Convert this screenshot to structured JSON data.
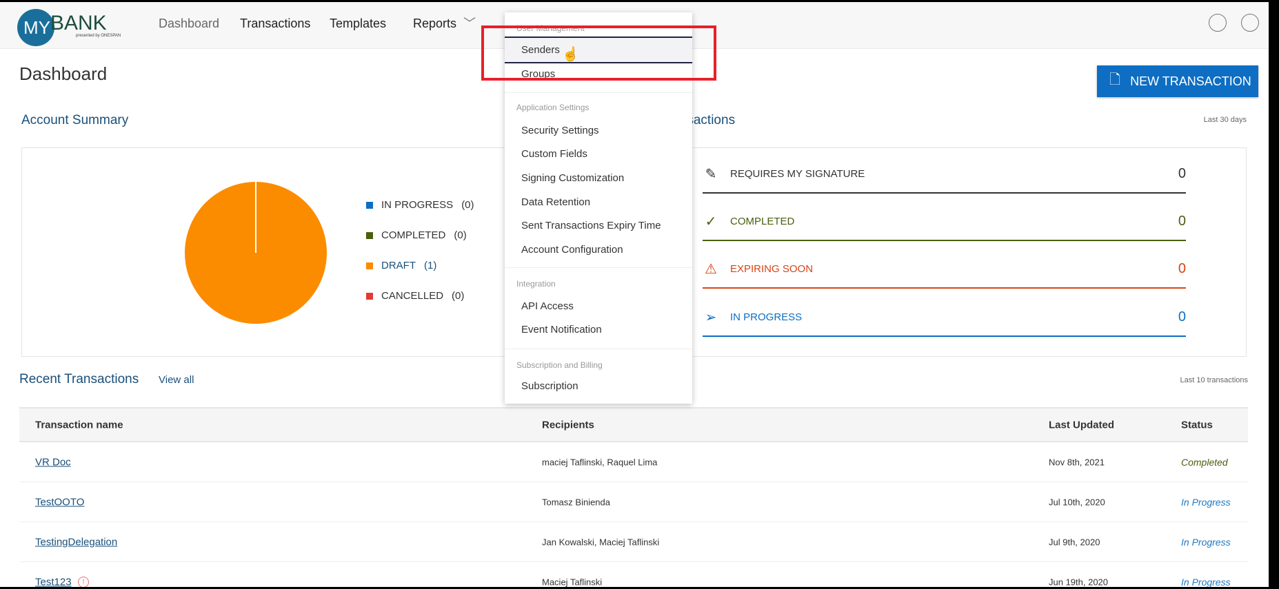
{
  "header": {
    "logo_my": "MY",
    "logo_bank": "BANK",
    "logo_sub": "presented by ONESPAN",
    "nav": [
      "Dashboard",
      "Transactions",
      "Templates",
      "Reports"
    ],
    "icons": [
      "globe-icon",
      "user-icon"
    ]
  },
  "page": {
    "title": "Dashboard",
    "new_transaction": "NEW TRANSACTION"
  },
  "summary": {
    "title": "Account Summary",
    "legend": [
      {
        "label": "IN PROGRESS",
        "count": "(0)",
        "color": "#0d6ec3"
      },
      {
        "label": "COMPLETED",
        "count": "(0)",
        "color": "#4a5e0e"
      },
      {
        "label": "DRAFT",
        "count": "(1)",
        "color": "#fb8c00"
      },
      {
        "label": "CANCELLED",
        "count": "(0)",
        "color": "#e53935"
      }
    ]
  },
  "chart_data": {
    "type": "pie",
    "categories": [
      "IN PROGRESS",
      "COMPLETED",
      "DRAFT",
      "CANCELLED"
    ],
    "values": [
      0,
      0,
      1,
      0
    ]
  },
  "transactions": {
    "title": "Transactions",
    "range": "Last 30 days",
    "stats": [
      {
        "label": "REQUIRES MY SIGNATURE",
        "value": "0",
        "icon": "pencil-icon",
        "color": "#333333"
      },
      {
        "label": "COMPLETED",
        "value": "0",
        "icon": "check-icon",
        "color": "#4a5e0e"
      },
      {
        "label": "EXPIRING SOON",
        "value": "0",
        "icon": "warning-icon",
        "color": "#d84315"
      },
      {
        "label": "IN PROGRESS",
        "value": "0",
        "icon": "send-icon",
        "color": "#0d6ec3"
      }
    ]
  },
  "recent": {
    "title": "Recent Transactions",
    "view_all": "View all",
    "range": "Last 10 transactions",
    "columns": [
      "Transaction name",
      "Recipients",
      "Last Updated",
      "Status"
    ],
    "rows": [
      {
        "name": "VR Doc",
        "recipients": "maciej Taflinski, Raquel Lima",
        "updated": "Nov 8th, 2021",
        "status": "Completed"
      },
      {
        "name": "TestOOTO",
        "recipients": "Tomasz Binienda",
        "updated": "Jul 10th, 2020",
        "status": "In Progress"
      },
      {
        "name": "TestingDelegation",
        "recipients": "Jan Kowalski, Maciej Taflinski",
        "updated": "Jul 9th, 2020",
        "status": "In Progress"
      },
      {
        "name": "Test123",
        "recipients": "Maciej Taflinski",
        "updated": "Jun 19th, 2020",
        "status": "In Progress"
      }
    ]
  },
  "menu": {
    "sections": [
      {
        "header": "User Management",
        "items": [
          "Senders",
          "Groups"
        ]
      },
      {
        "header": "Application Settings",
        "items": [
          "Security Settings",
          "Custom Fields",
          "Signing Customization",
          "Data Retention",
          "Sent Transactions Expiry Time",
          "Account Configuration"
        ]
      },
      {
        "header": "Integration",
        "items": [
          "API Access",
          "Event Notification"
        ]
      },
      {
        "header": "Subscription and Billing",
        "items": [
          "Subscription"
        ]
      }
    ],
    "hovered": "Senders"
  }
}
